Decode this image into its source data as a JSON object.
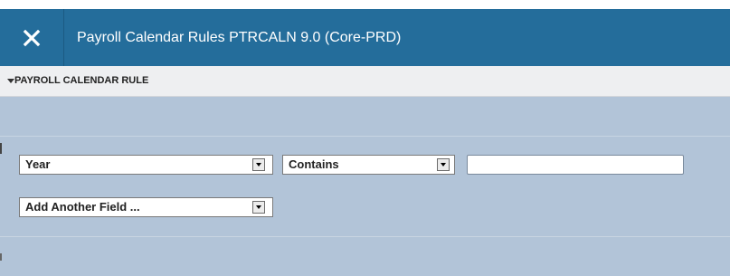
{
  "header": {
    "close_icon": "close-icon",
    "title": "Payroll Calendar Rules PTRCALN 9.0 (Core-PRD)"
  },
  "section": {
    "caret_icon": "caret-down-icon",
    "title": "PAYROLL CALENDAR RULE"
  },
  "filter": {
    "field_select": {
      "value": "Year"
    },
    "operator_select": {
      "value": "Contains"
    },
    "value_input": {
      "value": ""
    },
    "add_field_select": {
      "value": "Add Another Field ..."
    }
  },
  "colors": {
    "header_bg": "#246d9b",
    "section_bg": "#eeeff1",
    "panel_bg": "#b2c4d8"
  }
}
